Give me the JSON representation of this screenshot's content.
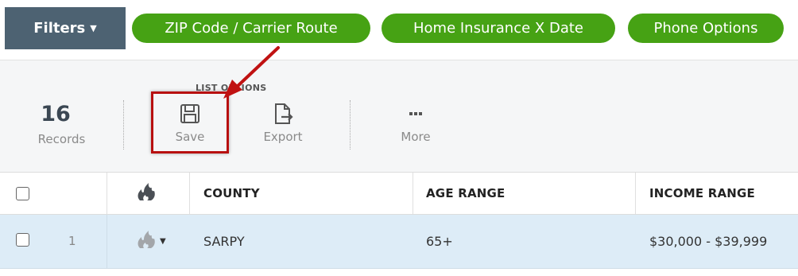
{
  "filterbar": {
    "filters_label": "Filters",
    "pills": [
      "ZIP Code / Carrier Route",
      "Home Insurance X Date",
      "Phone Options"
    ]
  },
  "toolbar": {
    "records_count": "16",
    "records_label": "Records",
    "section_label": "LIST OPTIONS",
    "save_label": "Save",
    "export_label": "Export",
    "more_label": "More"
  },
  "table": {
    "columns": [
      "COUNTY",
      "AGE RANGE",
      "INCOME RANGE"
    ],
    "rows": [
      {
        "num": "1",
        "county": "SARPY",
        "age_range": "65+",
        "income_range": "$30,000 - $39,999"
      }
    ]
  },
  "colors": {
    "filters_bg": "#4d6272",
    "pill_green": "#46a214",
    "highlight_red": "#b81010",
    "row_selected_bg": "#ddecf7"
  },
  "icons": {
    "filters_caret": "caret-down-icon",
    "save": "floppy-disk-icon",
    "export": "export-file-icon",
    "more": "ellipsis-icon",
    "heat": "flame-icon"
  }
}
